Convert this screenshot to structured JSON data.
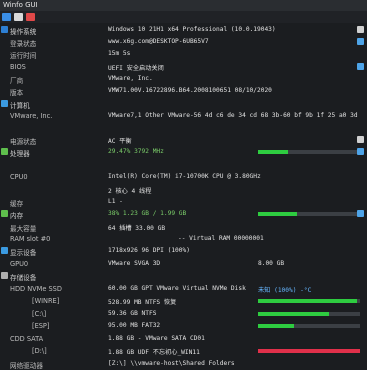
{
  "window": {
    "title": "Winfo GUI"
  },
  "toolbar": {
    "items": [
      "app-icon",
      "info-icon",
      "error-icon"
    ]
  },
  "os_section": {
    "label": "操作系统",
    "value": "Windows 10 21H1 x64 Professional (10.0.19043)"
  },
  "login": {
    "label": "登录状态",
    "value": "www.x6g.com@DESKTOP-6UB65V7"
  },
  "runtime": {
    "label": "运行时间",
    "value": "15m 5s"
  },
  "bios": {
    "label": "BIOS",
    "value": "UEFI 安全启动关闭"
  },
  "vendor": {
    "label": "厂商",
    "value": "VMware, Inc."
  },
  "version": {
    "label": "版本",
    "value": "VMW71.00V.16722896.B64.2008100651 08/10/2020"
  },
  "computer_section": {
    "label": "计算机"
  },
  "vmware": {
    "label": "VMware, Inc.",
    "value": "VMware7,1 Other VMware-56 4d c6 de 34 cd 68 3b-60 bf 9b 1f 25 a0 3d"
  },
  "power": {
    "label": "电源状态",
    "value": "AC  平衡"
  },
  "cpu_section": {
    "label": "处理器",
    "value": "29.47% 3792 MHz",
    "percent": 0.2947
  },
  "cpu": {
    "label": "CPU0",
    "value": "Intel(R) Core(TM) i7-10700K CPU @ 3.80GHz"
  },
  "cores": {
    "label": "",
    "value": "2 核心 4 线程"
  },
  "cache": {
    "label": "缓存",
    "value": "L1 -"
  },
  "memory_section": {
    "label": "内存",
    "value": "38% 1.23 GB / 1.99 GB",
    "percent": 0.38
  },
  "max_capacity": {
    "label": "最大容量",
    "value": "64 插槽 33.00 GB"
  },
  "ram_slot": {
    "label": "RAM slot #0",
    "value": "",
    "value2": "-- Virtual RAM 00000001"
  },
  "display_section": {
    "label": "显示设备",
    "value": "1718x926 96 DPI (100%)"
  },
  "gpu": {
    "label": "GPU0",
    "value": "VMware SVGA 3D",
    "value2": "8.00 GB"
  },
  "storage_section": {
    "label": "存储设备"
  },
  "nvme": {
    "label": "HDD NVMe SSD",
    "value": "60.00 GB GPT VMware Virtual NVMe Disk",
    "value2": "未知 (100%) -°C"
  },
  "winre": {
    "label": "[WINRE]",
    "value": "528.99 MB NTFS 恢复",
    "percent": 0.97
  },
  "c_drive": {
    "label": "[C:\\]",
    "value": "59.36 GB NTFS",
    "percent": 0.7
  },
  "esp": {
    "label": "[ESP]",
    "value": "95.00 MB FAT32",
    "percent": 0.35
  },
  "cd_sata": {
    "label": "CDD SATA",
    "value": "1.88 GB - VMware SATA CD01"
  },
  "d_drive": {
    "label": "[D:\\]",
    "value": "1.88 GB UDF 不忘初心_WIN11",
    "percent": 1.0
  },
  "network": {
    "label": "网络驱动器",
    "value": "[Z:\\] \\\\vmware-host\\Shared Folders"
  },
  "colors": {
    "green": "#2ecc40",
    "red": "#e0304a",
    "bar_bg": "#3b3f44"
  }
}
